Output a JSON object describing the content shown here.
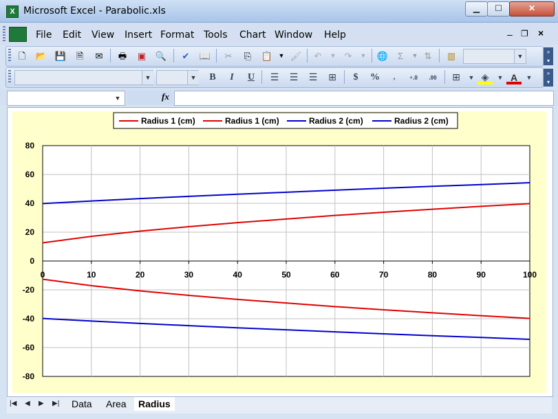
{
  "window": {
    "title": "Microsoft Excel - Parabolic.xls",
    "app_icon": "X",
    "controls": [
      "minimize-icon",
      "maximize-icon",
      "close-icon"
    ]
  },
  "menu": [
    "File",
    "Edit",
    "View",
    "Insert",
    "Format",
    "Tools",
    "Chart",
    "Window",
    "Help"
  ],
  "formula_bar": {
    "fx_label": "fx",
    "name_box": "",
    "content": ""
  },
  "colors": {
    "red_series": "#e00000",
    "blue_series": "#0000cc",
    "chart_area": "#ffffcc",
    "plot_area": "#ffffff"
  },
  "sheet_tabs": [
    "Data",
    "Area",
    "Radius"
  ],
  "active_tab": "Radius",
  "chart_data": {
    "type": "line",
    "title": "",
    "xlabel": "",
    "ylabel": "",
    "xlim": [
      0,
      100
    ],
    "ylim": [
      -80,
      80
    ],
    "x_ticks": [
      0,
      10,
      20,
      30,
      40,
      50,
      60,
      70,
      80,
      90,
      100
    ],
    "y_ticks": [
      80,
      60,
      40,
      20,
      0,
      -20,
      -40,
      -60,
      -80
    ],
    "grid": true,
    "legend": "top-center",
    "x": [
      0,
      10,
      20,
      30,
      40,
      50,
      60,
      70,
      80,
      90,
      100
    ],
    "series": [
      {
        "name": "Radius 1 (cm)",
        "color": "#e00000",
        "values": [
          12.6,
          17.1,
          20.7,
          23.8,
          26.6,
          29.1,
          31.6,
          33.8,
          35.9,
          37.9,
          39.8
        ]
      },
      {
        "name": "Radius 1 (cm)",
        "color": "#e00000",
        "values": [
          -12.6,
          -17.1,
          -20.7,
          -23.8,
          -26.6,
          -29.1,
          -31.6,
          -33.8,
          -35.9,
          -37.9,
          -39.8
        ]
      },
      {
        "name": "Radius 2 (cm)",
        "color": "#0000cc",
        "values": [
          39.8,
          41.6,
          43.3,
          44.8,
          46.3,
          47.7,
          49.1,
          50.5,
          51.8,
          53.0,
          54.3
        ]
      },
      {
        "name": "Radius 2 (cm)",
        "color": "#0000cc",
        "values": [
          -39.8,
          -41.6,
          -43.3,
          -44.8,
          -46.3,
          -47.7,
          -49.1,
          -50.5,
          -51.8,
          -53.0,
          -54.3
        ]
      }
    ]
  }
}
